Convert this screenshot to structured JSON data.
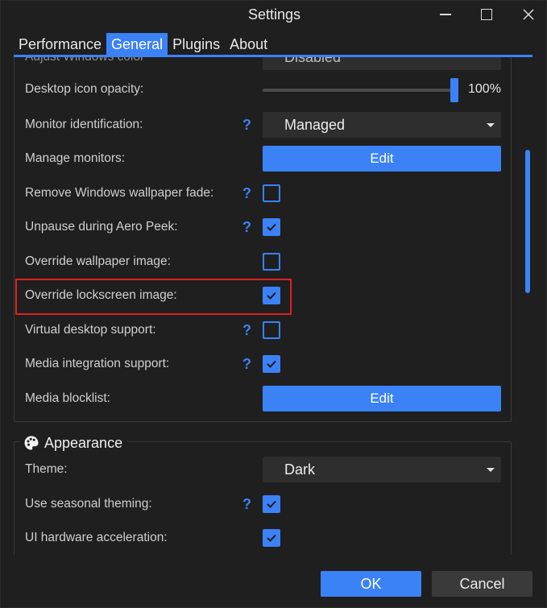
{
  "window": {
    "title": "Settings"
  },
  "tabs": [
    {
      "label": "Performance",
      "active": false
    },
    {
      "label": "General",
      "active": true
    },
    {
      "label": "Plugins",
      "active": false
    },
    {
      "label": "About",
      "active": false
    }
  ],
  "general": {
    "partial_row": {
      "label": "Adjust Windows color",
      "value": "Disabled"
    },
    "desktop_icon_opacity": {
      "label": "Desktop icon opacity:",
      "value": "100%"
    },
    "monitor_identification": {
      "label": "Monitor identification:",
      "help": "?",
      "value": "Managed"
    },
    "manage_monitors": {
      "label": "Manage monitors:",
      "button": "Edit"
    },
    "remove_wallpaper_fade": {
      "label": "Remove Windows wallpaper fade:",
      "help": "?",
      "checked": false
    },
    "unpause_aero_peek": {
      "label": "Unpause during Aero Peek:",
      "help": "?",
      "checked": true
    },
    "override_wallpaper": {
      "label": "Override wallpaper image:",
      "checked": false
    },
    "override_lockscreen": {
      "label": "Override lockscreen image:",
      "checked": true
    },
    "virtual_desktop": {
      "label": "Virtual desktop support:",
      "help": "?",
      "checked": false
    },
    "media_integration": {
      "label": "Media integration support:",
      "help": "?",
      "checked": true
    },
    "media_blocklist": {
      "label": "Media blocklist:",
      "button": "Edit"
    }
  },
  "appearance": {
    "header": "Appearance",
    "icon": "palette-icon",
    "theme": {
      "label": "Theme:",
      "value": "Dark"
    },
    "seasonal_theming": {
      "label": "Use seasonal theming:",
      "help": "?",
      "checked": true
    },
    "ui_hw_accel": {
      "label": "UI hardware acceleration:",
      "checked": true
    }
  },
  "footer": {
    "ok": "OK",
    "cancel": "Cancel"
  },
  "colors": {
    "accent": "#3b82f6",
    "background": "#1f1f1f",
    "highlight": "#e02020"
  }
}
